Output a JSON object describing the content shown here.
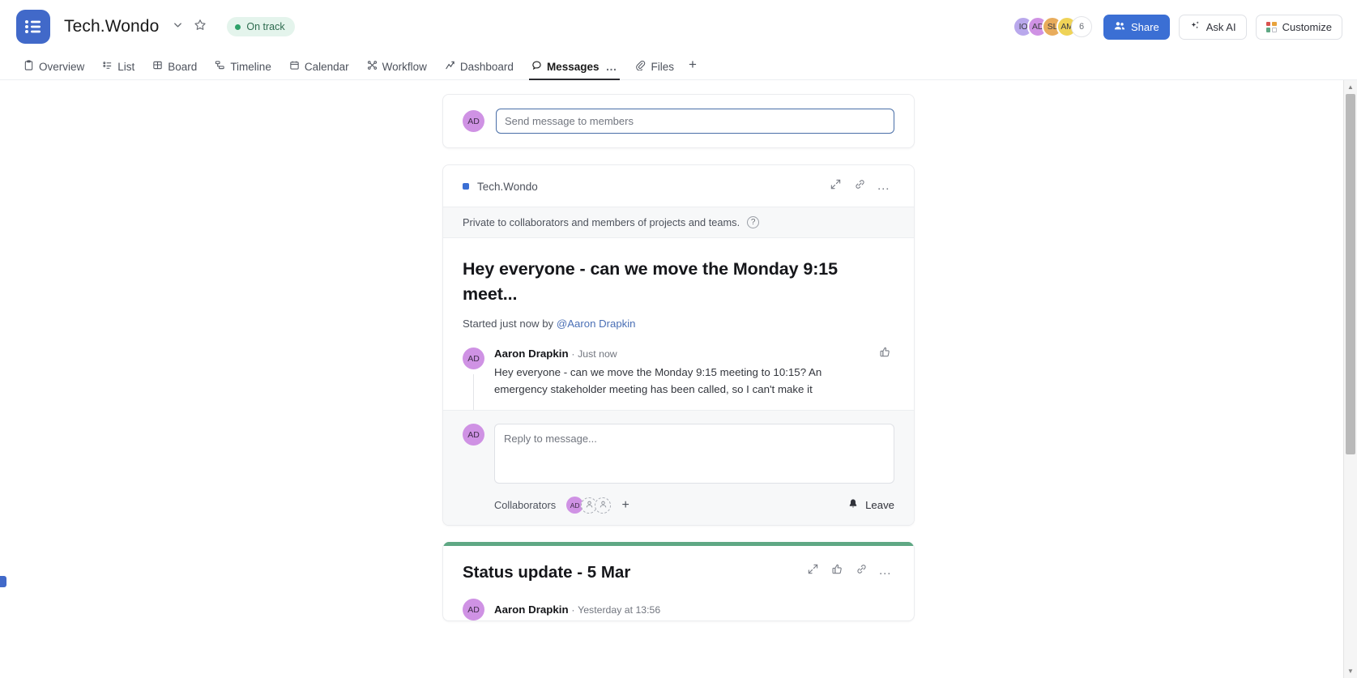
{
  "header": {
    "logo_icon": "list-logo-icon",
    "project_title": "Tech.Wondo",
    "caret_icon": "chevron-down-icon",
    "star_icon": "star-icon",
    "status": {
      "label": "On track",
      "dot_color": "#2ea169",
      "bg_color": "#e4f4ec",
      "text_color": "#2e6b4f"
    },
    "avatars": [
      {
        "initials": "IO",
        "color": "#b9a8ec"
      },
      {
        "initials": "AD",
        "color": "#cf92e4"
      },
      {
        "initials": "SL",
        "color": "#e8ac5c"
      },
      {
        "initials": "AM",
        "color": "#efd357"
      }
    ],
    "avatar_overflow": "6",
    "share_label": "Share",
    "share_icon": "people-icon",
    "share_color": "#3b6fd4",
    "ask_ai_label": "Ask AI",
    "ask_ai_icon": "sparkles-icon",
    "customize_label": "Customize",
    "customize_icon": "color-grid-icon",
    "customize_swatches": [
      "#d9534f",
      "#e8a33d",
      "#5fa884",
      "#ffffff"
    ]
  },
  "tabs": [
    {
      "label": "Overview",
      "icon": "clipboard-icon",
      "active": false
    },
    {
      "label": "List",
      "icon": "list-icon",
      "active": false
    },
    {
      "label": "Board",
      "icon": "board-icon",
      "active": false
    },
    {
      "label": "Timeline",
      "icon": "timeline-icon",
      "active": false
    },
    {
      "label": "Calendar",
      "icon": "calendar-icon",
      "active": false
    },
    {
      "label": "Workflow",
      "icon": "workflow-icon",
      "active": false
    },
    {
      "label": "Dashboard",
      "icon": "chart-icon",
      "active": false
    },
    {
      "label": "Messages",
      "icon": "message-icon",
      "active": true,
      "overflow": "…"
    },
    {
      "label": "Files",
      "icon": "paperclip-icon",
      "active": false
    }
  ],
  "tab_add_label": "+",
  "composer": {
    "avatar_initials": "AD",
    "avatar_color": "#cf92e4",
    "placeholder": "Send message to members",
    "value": "",
    "focused": true,
    "border_color": "#4a6fa8"
  },
  "thread": {
    "project_name": "Tech.Wondo",
    "project_dot_color": "#3b6fd4",
    "actions": [
      {
        "icon": "expand-icon",
        "label": ""
      },
      {
        "icon": "link-icon",
        "label": ""
      },
      {
        "icon": "more-horizontal-icon",
        "label": "…"
      }
    ],
    "privacy_note": "Private to collaborators and members of projects and teams.",
    "privacy_help_icon": "question-mark-icon",
    "privacy_help_glyph": "?",
    "title": "Hey everyone - can we move the Monday 9:15 meet...",
    "meta_prefix": "Started just now by",
    "meta_mention": "@Aaron Drapkin",
    "comment": {
      "avatar_initials": "AD",
      "avatar_color": "#cf92e4",
      "author": "Aaron Drapkin",
      "separator": "·",
      "time": "Just now",
      "text": "Hey everyone - can we move the Monday 9:15 meeting to 10:15? An emergency stakeholder meeting has been called, so I can't make it",
      "like_icon": "thumbs-up-icon"
    },
    "reply": {
      "avatar_initials": "AD",
      "avatar_color": "#cf92e4",
      "placeholder": "Reply to message...",
      "value": ""
    },
    "collaborators_label": "Collaborators",
    "collaborator_avatars": [
      {
        "initials": "AD",
        "color": "#cf92e4"
      }
    ],
    "collaborator_placeholders": 2,
    "collaborator_placeholder_icon": "person-outline-icon",
    "collaborator_add_label": "+",
    "leave_label": "Leave",
    "leave_icon": "bell-icon"
  },
  "status_card": {
    "accent_color": "#5fa884",
    "title": "Status update - 5 Mar",
    "actions": [
      {
        "icon": "expand-icon"
      },
      {
        "icon": "thumbs-up-icon"
      },
      {
        "icon": "link-icon"
      },
      {
        "icon": "more-horizontal-icon",
        "label": "…"
      }
    ],
    "author_avatar_initials": "AD",
    "author_avatar_color": "#cf92e4",
    "author": "Aaron Drapkin",
    "separator": "·",
    "time": "Yesterday at 13:56"
  },
  "scrollbar": {
    "up_glyph": "▲",
    "down_glyph": "▼"
  }
}
